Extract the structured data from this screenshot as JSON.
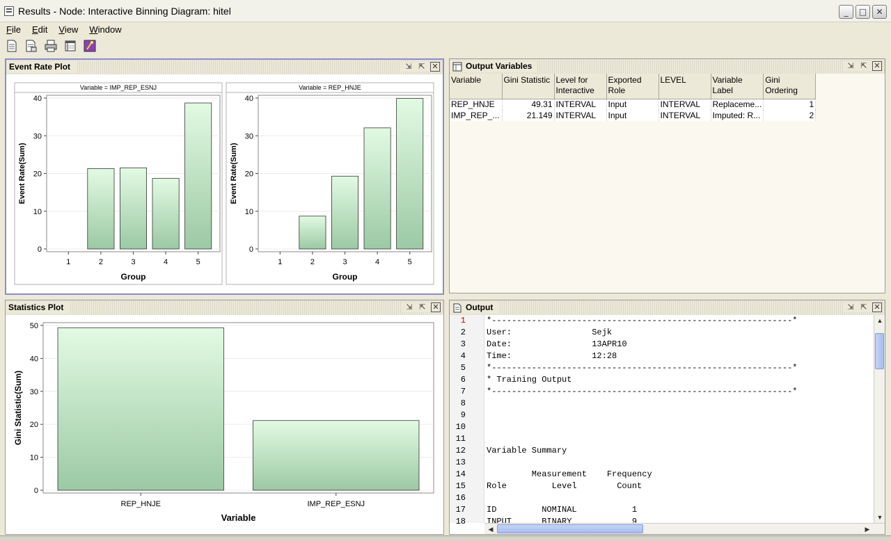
{
  "window": {
    "title": "Results - Node: Interactive Binning  Diagram: hitel",
    "controls": [
      "_",
      "□",
      "✕"
    ]
  },
  "menu": [
    {
      "label": "File",
      "mnemonic": "F",
      "rest": "ile"
    },
    {
      "label": "Edit",
      "mnemonic": "E",
      "rest": "dit"
    },
    {
      "label": "View",
      "mnemonic": "V",
      "rest": "iew"
    },
    {
      "label": "Window",
      "mnemonic": "W",
      "rest": "indow"
    }
  ],
  "toolbar": [
    "new-document-icon",
    "properties-document-icon",
    "print-icon",
    "table-view-icon",
    "magic-wand-icon"
  ],
  "event_panel": {
    "title": "Event Rate Plot"
  },
  "output_vars_panel": {
    "title": "Output Variables",
    "columns": [
      "Variable",
      "Gini Statistic",
      "Level for Interactive",
      "Exported Role",
      "LEVEL",
      "Variable Label",
      "Gini Ordering"
    ],
    "rows": [
      [
        "REP_HNJE",
        "49.31",
        "INTERVAL",
        "Input",
        "INTERVAL",
        "Replaceme...",
        "1"
      ],
      [
        "IMP_REP_...",
        "21.149",
        "INTERVAL",
        "Input",
        "INTERVAL",
        "Imputed: R...",
        "2"
      ]
    ]
  },
  "stats_panel": {
    "title": "Statistics Plot"
  },
  "output_panel": {
    "title": "Output",
    "line_numbers": [
      "1",
      "2",
      "3",
      "4",
      "5",
      "6",
      "7",
      "8",
      "9",
      "10",
      "11",
      "12",
      "13",
      "14",
      "15",
      "16",
      "17",
      "18"
    ],
    "lines": [
      "*------------------------------------------------------------*",
      "User:                Sejk",
      "Date:                13APR10",
      "Time:                12:28",
      "*------------------------------------------------------------*",
      "* Training Output",
      "*------------------------------------------------------------*",
      "",
      "",
      "",
      "",
      "Variable Summary",
      "",
      "         Measurement    Frequency",
      "Role         Level        Count",
      "",
      "ID         NOMINAL           1",
      "INPUT      BINARY            9"
    ]
  },
  "chart_data": [
    {
      "type": "bar",
      "panel_label": "Variable = IMP_REP_ESNJ",
      "categories": [
        "1",
        "2",
        "3",
        "4",
        "5"
      ],
      "values": [
        0,
        21.3,
        21.5,
        18.7,
        38.7
      ],
      "xlabel": "Group",
      "ylabel": "Event Rate(Sum)",
      "ylim": [
        0,
        40
      ],
      "yticks": [
        "0",
        "10",
        "20",
        "30",
        "40"
      ],
      "bar_color": "#cbeed0"
    },
    {
      "type": "bar",
      "panel_label": "Variable = REP_HNJE",
      "categories": [
        "1",
        "2",
        "3",
        "4",
        "5"
      ],
      "values": [
        0,
        8.7,
        19.3,
        32.1,
        39.9
      ],
      "xlabel": "Group",
      "ylabel": "Event Rate(Sum)",
      "ylim": [
        0,
        40
      ],
      "yticks": [
        "0",
        "10",
        "20",
        "30",
        "40"
      ],
      "bar_color": "#cbeed0"
    },
    {
      "type": "bar",
      "categories": [
        "REP_HNJE",
        "IMP_REP_ESNJ"
      ],
      "values": [
        49.31,
        21.149
      ],
      "xlabel": "Variable",
      "ylabel": "Gini Statistic(Sum)",
      "ylim": [
        0,
        50
      ],
      "yticks": [
        "0",
        "10",
        "20",
        "30",
        "40",
        "50"
      ],
      "bar_color": "#cbeed0"
    }
  ]
}
